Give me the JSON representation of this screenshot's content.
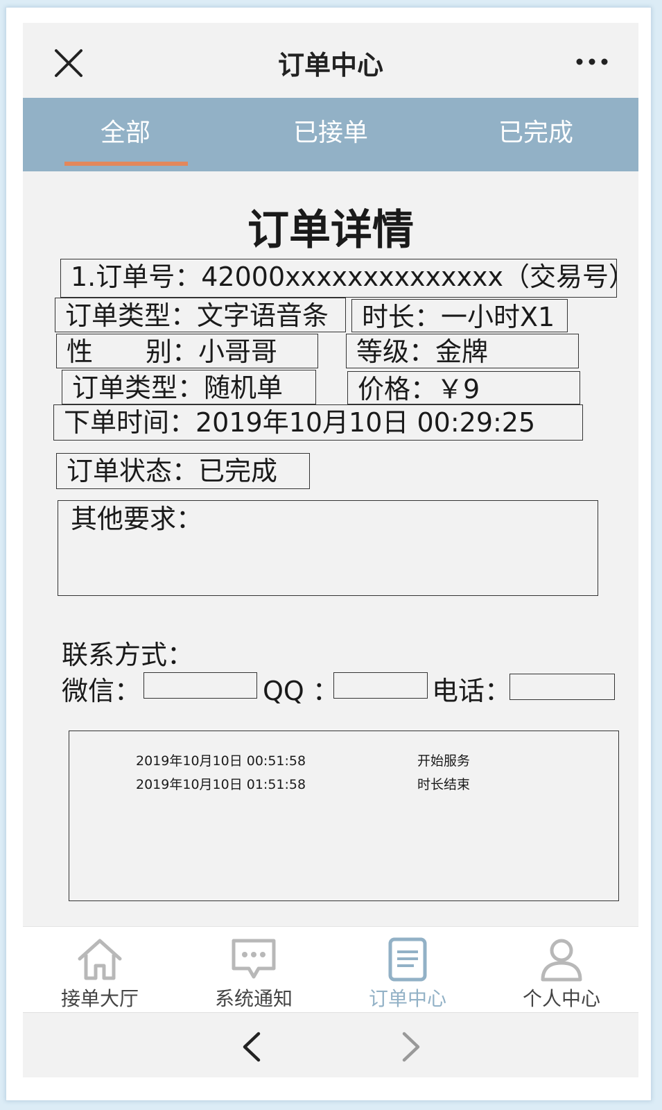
{
  "header": {
    "title": "订单中心",
    "close_icon": "close-icon",
    "more_icon": "more-dots-icon"
  },
  "tabs": [
    {
      "label": "全部",
      "active": true
    },
    {
      "label": "已接单",
      "active": false
    },
    {
      "label": "已完成",
      "active": false
    }
  ],
  "accent_color": "#e3875b",
  "tabbar_color": "#92b1c6",
  "detail": {
    "title": "订单详情",
    "order_no": "1.订单号：42000xxxxxxxxxxxxxx（交易号）",
    "order_type": "订单类型：文字语音条",
    "duration": "时长：一小时X1",
    "gender": "性　　别：小哥哥",
    "level": " 等级：金牌",
    "order_type2": "订单类型：随机单",
    "price": " 价格：￥9",
    "order_time": "下单时间：2019年10月10日 00:29:25",
    "status": "订单状态：已完成",
    "other_requirements": "其他要求："
  },
  "contact": {
    "label": "联系方式：",
    "wechat_label": "微信：",
    "wechat_value": "",
    "qq_label": "QQ ：",
    "qq_value": "",
    "phone_label": "电话：",
    "phone_value": ""
  },
  "log": [
    {
      "time": "2019年10月10日 00:51:58",
      "event": "开始服务"
    },
    {
      "time": "2019年10月10日 01:51:58",
      "event": "时长结束"
    }
  ],
  "bottom_nav": [
    {
      "label": "接单大厅",
      "icon": "home-icon",
      "active": false
    },
    {
      "label": "系统通知",
      "icon": "chat-bubble-icon",
      "active": false
    },
    {
      "label": "订单中心",
      "icon": "document-icon",
      "active": true
    },
    {
      "label": "个人中心",
      "icon": "person-icon",
      "active": false
    }
  ],
  "browser": {
    "back_icon": "chevron-left-icon",
    "forward_icon": "chevron-right-icon"
  }
}
